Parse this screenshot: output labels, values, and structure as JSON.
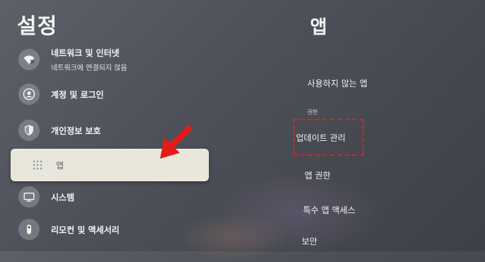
{
  "left": {
    "title": "설정",
    "items": [
      {
        "label": "네트워크 및 인터넷",
        "sub": "네트워크에 연결되지 않음",
        "icon": "wifi-off-icon"
      },
      {
        "label": "계정 및 로그인",
        "icon": "account-icon"
      },
      {
        "label": "개인정보 보호",
        "icon": "shield-icon"
      },
      {
        "label": "앱",
        "icon": "apps-grid-icon",
        "selected": true
      },
      {
        "label": "시스템",
        "icon": "monitor-icon"
      },
      {
        "label": "리모컨 및 액세서리",
        "icon": "remote-icon"
      }
    ]
  },
  "right": {
    "title": "앱",
    "items": [
      {
        "label": "사용하지 않는 앱"
      },
      {
        "caption": "권한"
      },
      {
        "label": "업데이트 관리",
        "highlighted": true
      },
      {
        "label": "앱 권한"
      },
      {
        "label": "특수 앱 액세스"
      },
      {
        "label": "보안"
      }
    ]
  },
  "annotations": {
    "arrow_color": "#e41b1b",
    "highlight_color": "#e02020"
  }
}
